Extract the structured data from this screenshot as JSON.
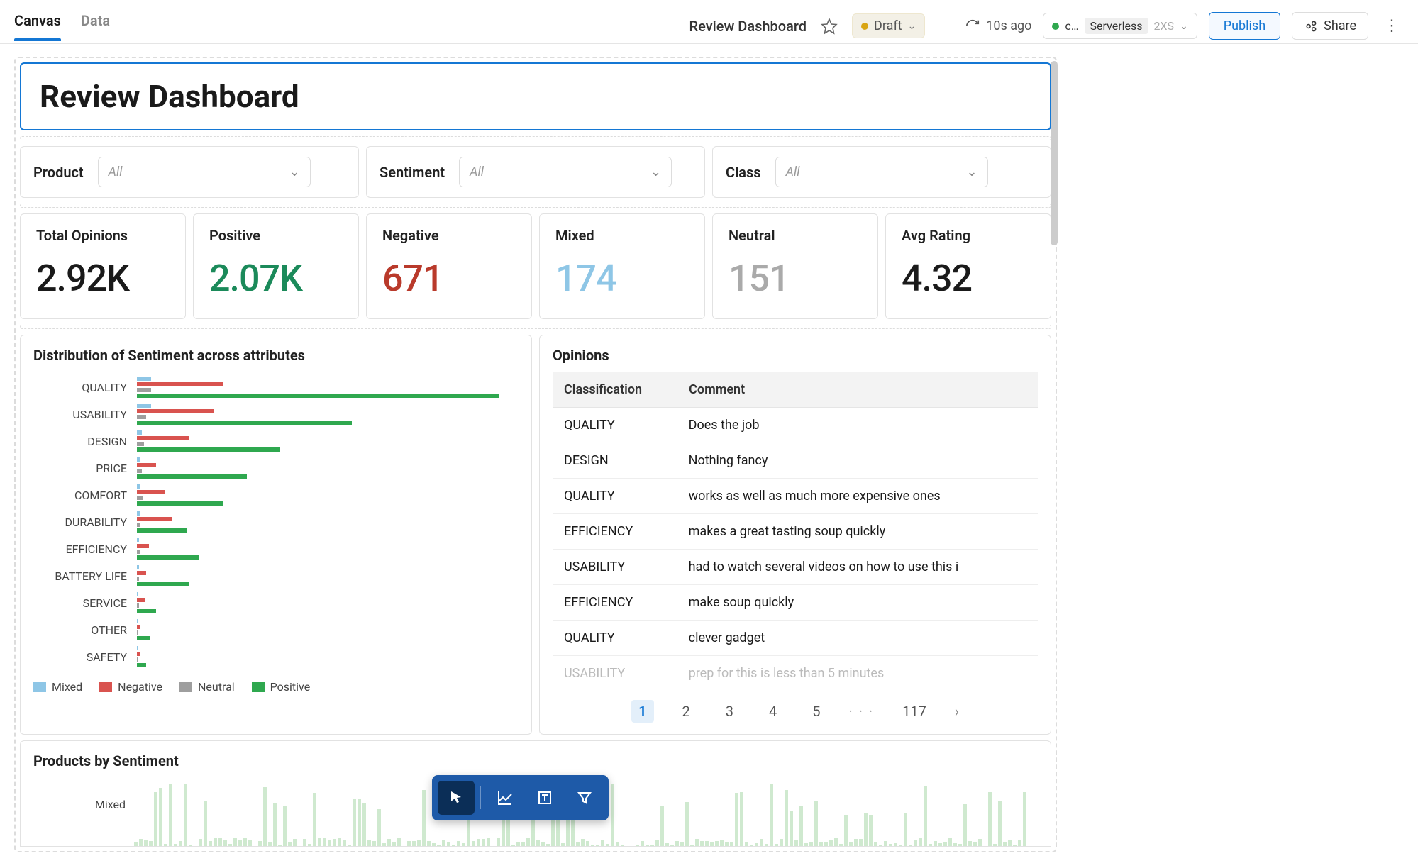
{
  "header": {
    "tabs": [
      {
        "label": "Canvas",
        "active": true
      },
      {
        "label": "Data",
        "active": false
      }
    ],
    "doc_title": "Review Dashboard",
    "status": {
      "label": "Draft"
    },
    "refresh_ago": "10s ago",
    "compute": {
      "name_short": "c…",
      "type": "Serverless",
      "size": "2XS"
    },
    "publish_label": "Publish",
    "share_label": "Share"
  },
  "page_title": "Review Dashboard",
  "filters": [
    {
      "label": "Product",
      "placeholder": "All"
    },
    {
      "label": "Sentiment",
      "placeholder": "All"
    },
    {
      "label": "Class",
      "placeholder": "All"
    }
  ],
  "metrics": [
    {
      "label": "Total Opinions",
      "value": "2.92K",
      "color": "c-black"
    },
    {
      "label": "Positive",
      "value": "2.07K",
      "color": "c-green"
    },
    {
      "label": "Negative",
      "value": "671",
      "color": "c-red"
    },
    {
      "label": "Mixed",
      "value": "174",
      "color": "c-blue"
    },
    {
      "label": "Neutral",
      "value": "151",
      "color": "c-gray"
    },
    {
      "label": "Avg Rating",
      "value": "4.32",
      "color": "c-black"
    }
  ],
  "chart_data": {
    "type": "bar",
    "orientation": "horizontal",
    "title": "Distribution of Sentiment across attributes",
    "categories": [
      "QUALITY",
      "USABILITY",
      "DESIGN",
      "PRICE",
      "COMFORT",
      "DURABILITY",
      "EFFICIENCY",
      "BATTERY LIFE",
      "SERVICE",
      "OTHER",
      "SAFETY"
    ],
    "series": [
      {
        "name": "Mixed",
        "color": "#8ec6e6",
        "values": [
          30,
          30,
          10,
          8,
          6,
          6,
          5,
          4,
          3,
          2,
          2
        ]
      },
      {
        "name": "Negative",
        "color": "#d9534f",
        "values": [
          180,
          160,
          110,
          40,
          60,
          75,
          25,
          20,
          18,
          8,
          6
        ]
      },
      {
        "name": "Neutral",
        "color": "#9e9e9e",
        "values": [
          30,
          20,
          15,
          10,
          12,
          8,
          6,
          5,
          5,
          3,
          3
        ]
      },
      {
        "name": "Positive",
        "color": "#2fa84f",
        "values": [
          760,
          450,
          300,
          230,
          180,
          105,
          130,
          110,
          40,
          28,
          20
        ]
      }
    ],
    "xlim": [
      0,
      800
    ],
    "legend_position": "bottom"
  },
  "opinions": {
    "title": "Opinions",
    "columns": [
      "Classification",
      "Comment"
    ],
    "rows": [
      {
        "class": "QUALITY",
        "comment": "Does the job"
      },
      {
        "class": "DESIGN",
        "comment": "Nothing fancy"
      },
      {
        "class": "QUALITY",
        "comment": "works as well as much more expensive ones"
      },
      {
        "class": "EFFICIENCY",
        "comment": "makes a great tasting soup quickly"
      },
      {
        "class": "USABILITY",
        "comment": "had to watch several videos on how to use this i"
      },
      {
        "class": "EFFICIENCY",
        "comment": "make soup quickly"
      },
      {
        "class": "QUALITY",
        "comment": "clever gadget"
      },
      {
        "class": "USABILITY",
        "comment": "prep for this is less than 5 minutes"
      }
    ],
    "pager": {
      "pages": [
        "1",
        "2",
        "3",
        "4",
        "5"
      ],
      "active": "1",
      "last": "117"
    }
  },
  "bottom_panel": {
    "title": "Products by Sentiment",
    "row_label": "Mixed"
  },
  "float_toolbar": {
    "tools": [
      "cursor",
      "chart",
      "text",
      "filter"
    ],
    "active": "cursor"
  }
}
